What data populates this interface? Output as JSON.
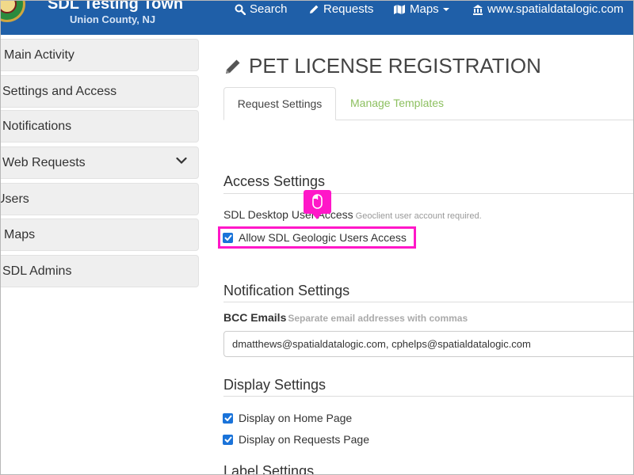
{
  "navbar": {
    "title": "SDL Testing Town",
    "subtitle": "Union County, NJ",
    "search": "Search",
    "requests": "Requests",
    "maps": "Maps",
    "website": "www.spatialdatalogic.com",
    "color": "#1f5fa8"
  },
  "sidebar": {
    "items": [
      {
        "label": "Main Activity"
      },
      {
        "label": "Settings and Access"
      },
      {
        "label": "Notifications"
      },
      {
        "label": "Web Requests",
        "icon": "chevron-down-icon"
      },
      {
        "label": "Users"
      },
      {
        "label": "Maps"
      },
      {
        "label": "SDL Admins"
      }
    ]
  },
  "page": {
    "title": "PET LICENSE REGISTRATION",
    "tabs": [
      {
        "label": "Request Settings",
        "active": true
      },
      {
        "label": "Manage Templates",
        "active": false
      }
    ]
  },
  "access": {
    "heading": "Access Settings",
    "desktop_label": "SDL Desktop User Access",
    "desktop_help": "Geoclient user account required.",
    "geologic_label": "Allow SDL Geologic Users Access",
    "geologic_checked": true
  },
  "notification": {
    "heading": "Notification Settings",
    "bcc_label": "BCC Emails",
    "bcc_help": "Separate email addresses with commas",
    "bcc_value": "dmatthews@spatialdatalogic.com, cphelps@spatialdatalogic.com"
  },
  "display": {
    "heading": "Display Settings",
    "home_label": "Display on Home Page",
    "home_checked": true,
    "requests_label": "Display on Requests Page",
    "requests_checked": true
  },
  "label_settings": {
    "heading": "Label Settings"
  },
  "annotation": {
    "highlight_color": "#ff17c8",
    "cursor_icon": "mouse-icon"
  }
}
